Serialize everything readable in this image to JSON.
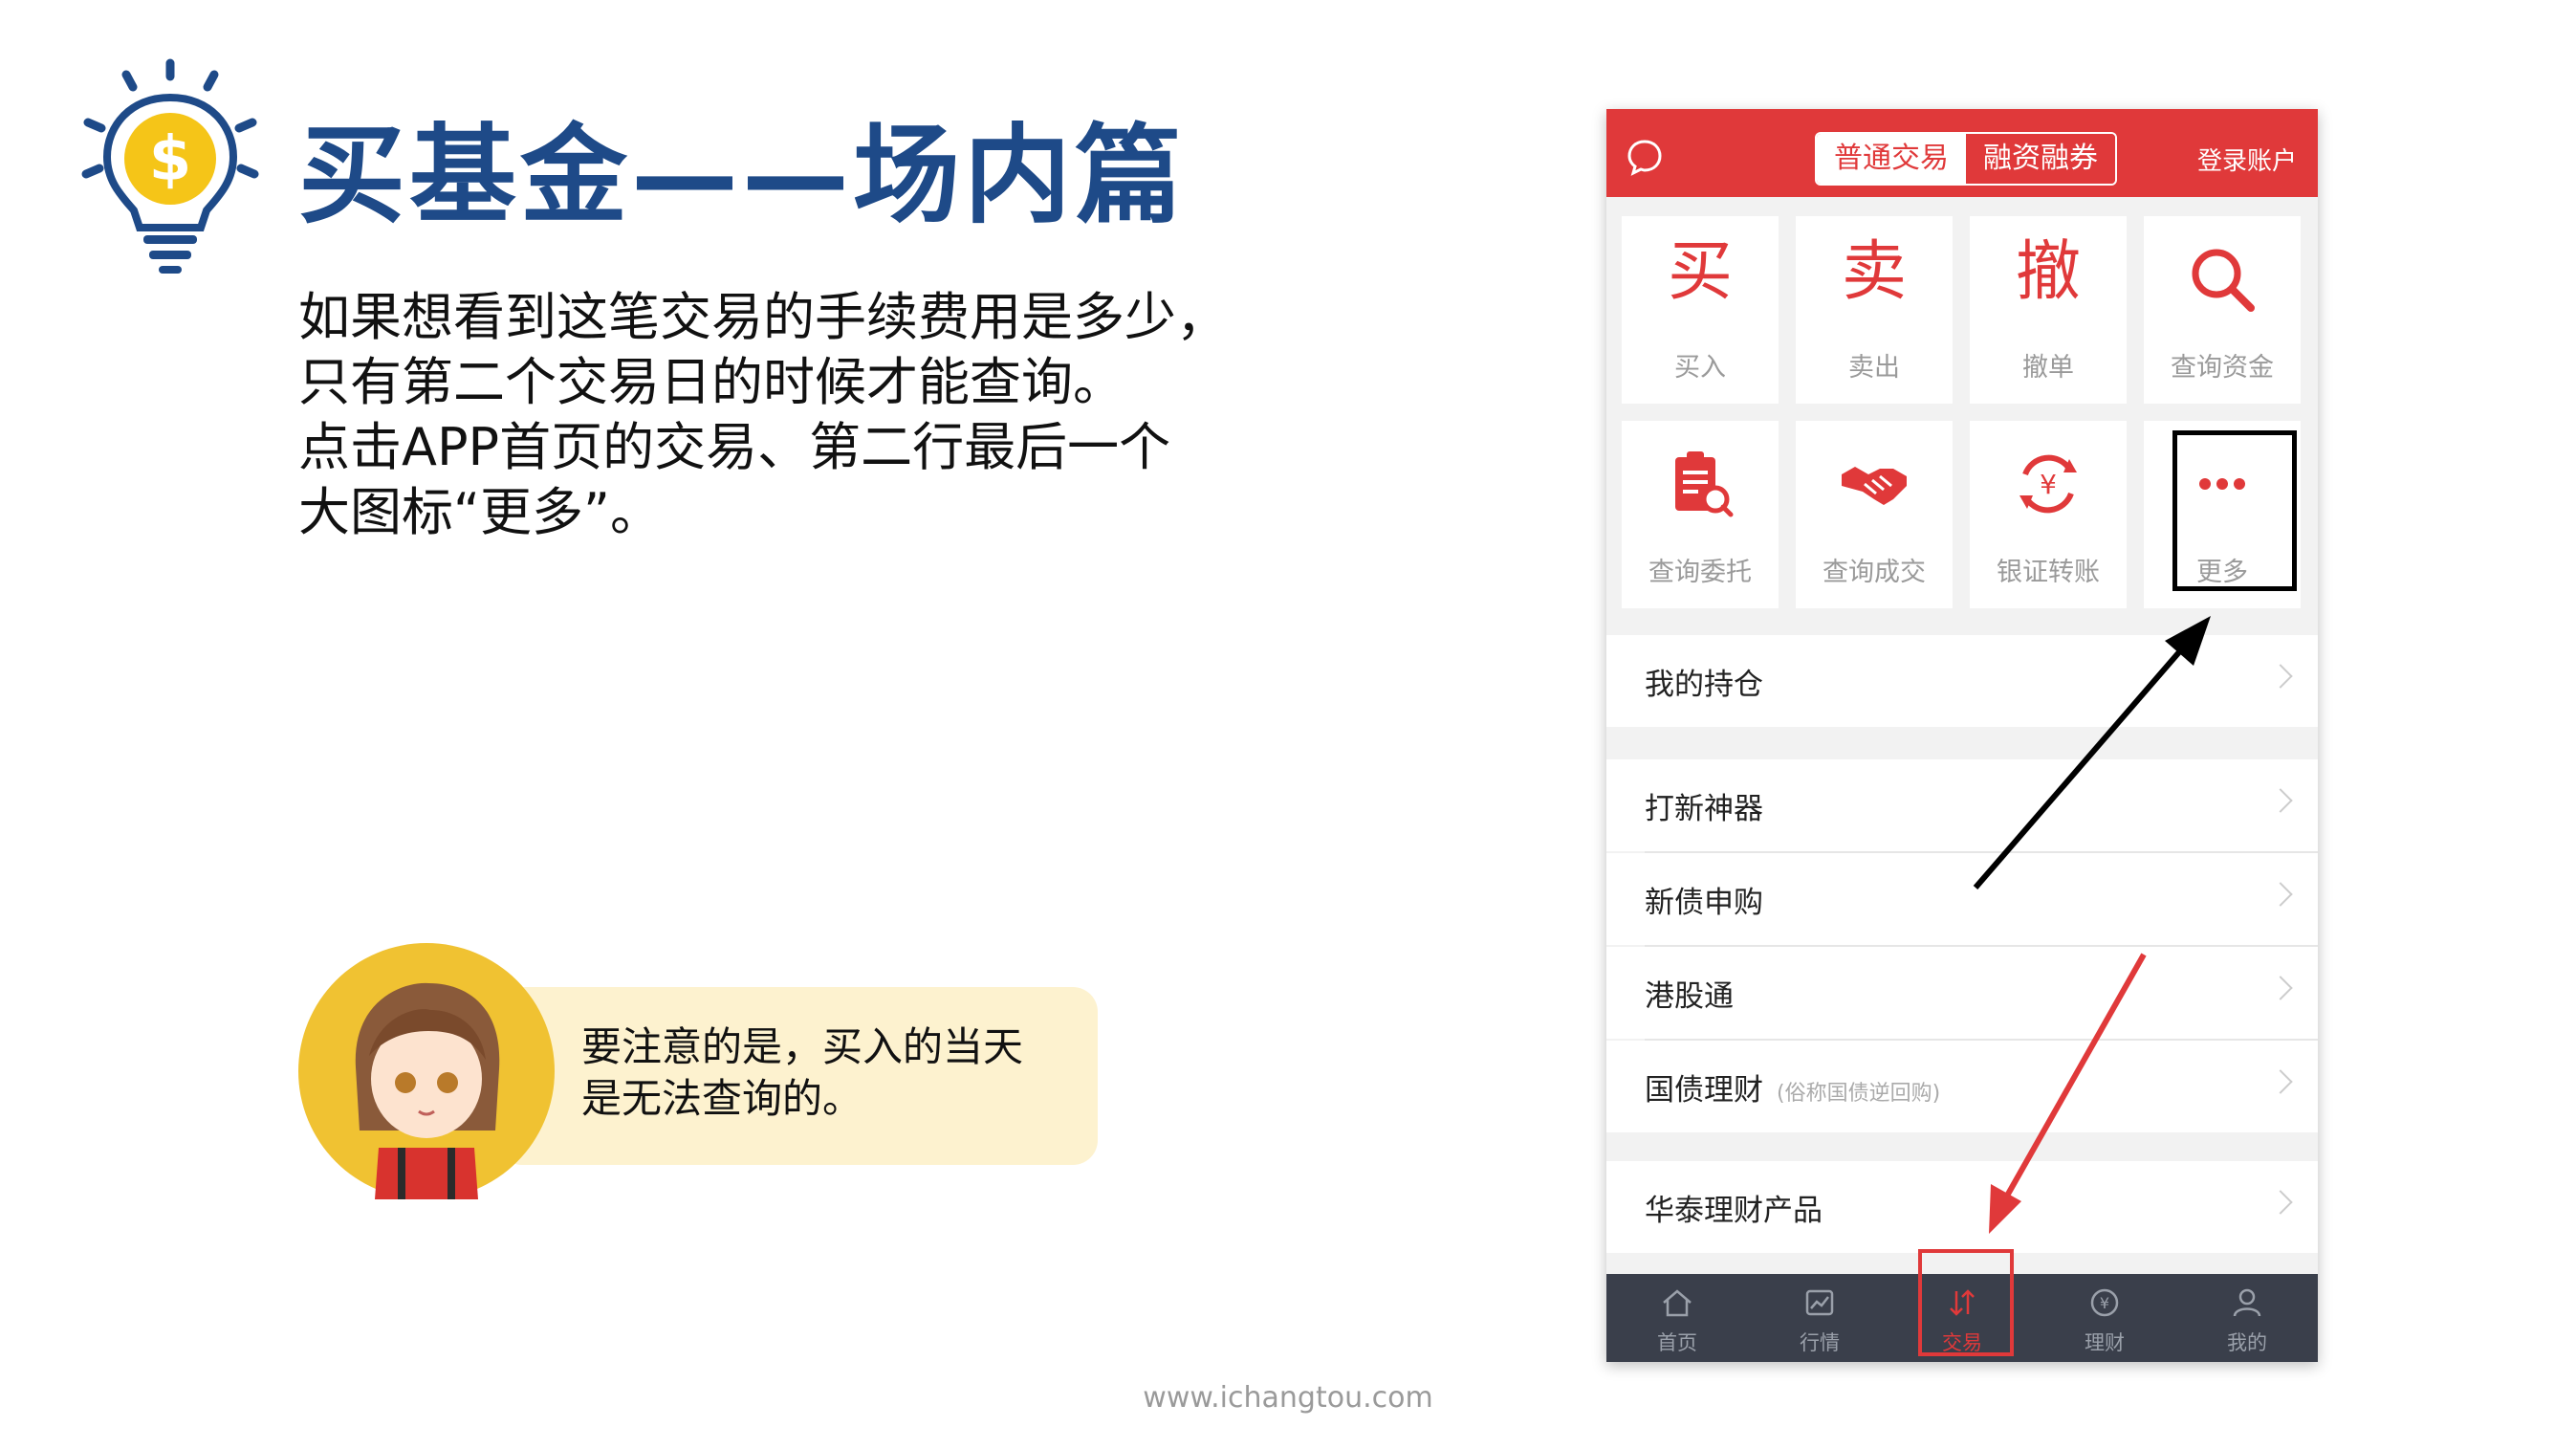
{
  "slide": {
    "title": "买基金——场内篇",
    "body_lines": [
      "如果想看到这笔交易的手续费用是多少，",
      "只有第二个交易日的时候才能查询。",
      "点击APP首页的交易、第二行最后一个",
      "大图标“更多”。"
    ],
    "tip_lines": [
      "要注意的是，买入的当天",
      "是无法查询的。"
    ],
    "footer": "www.ichangtou.com",
    "colors": {
      "title": "#1e4a88",
      "accent": "#e0393a",
      "bulb": "#f5c518",
      "tip_bg": "#fdf2cf"
    }
  },
  "app": {
    "header": {
      "chat_icon": "chat-bubble-icon",
      "segments": [
        "普通交易",
        "融资融券"
      ],
      "login": "登录账户"
    },
    "tiles": [
      {
        "glyph": "买",
        "label": "买入"
      },
      {
        "glyph": "卖",
        "label": "卖出"
      },
      {
        "glyph": "撤",
        "label": "撤单"
      },
      {
        "icon": "search-icon",
        "label": "查询资金"
      },
      {
        "icon": "clipboard-search-icon",
        "label": "查询委托"
      },
      {
        "icon": "handshake-icon",
        "label": "查询成交"
      },
      {
        "icon": "yen-transfer-icon",
        "label": "银证转账"
      },
      {
        "icon": "more-dots-icon",
        "label": "更多"
      }
    ],
    "rows": [
      {
        "label": "我的持仓",
        "sub": ""
      },
      {
        "label": "打新神器",
        "sub": ""
      },
      {
        "label": "新债申购",
        "sub": ""
      },
      {
        "label": "港股通",
        "sub": ""
      },
      {
        "label": "国债理财",
        "sub": "(俗称国债逆回购)"
      },
      {
        "label": "华泰理财产品",
        "sub": ""
      }
    ],
    "tabs": [
      {
        "icon": "home-icon",
        "label": "首页"
      },
      {
        "icon": "chart-icon",
        "label": "行情"
      },
      {
        "icon": "trade-arrows-icon",
        "label": "交易"
      },
      {
        "icon": "yen-circle-icon",
        "label": "理财"
      },
      {
        "icon": "user-icon",
        "label": "我的"
      }
    ]
  }
}
